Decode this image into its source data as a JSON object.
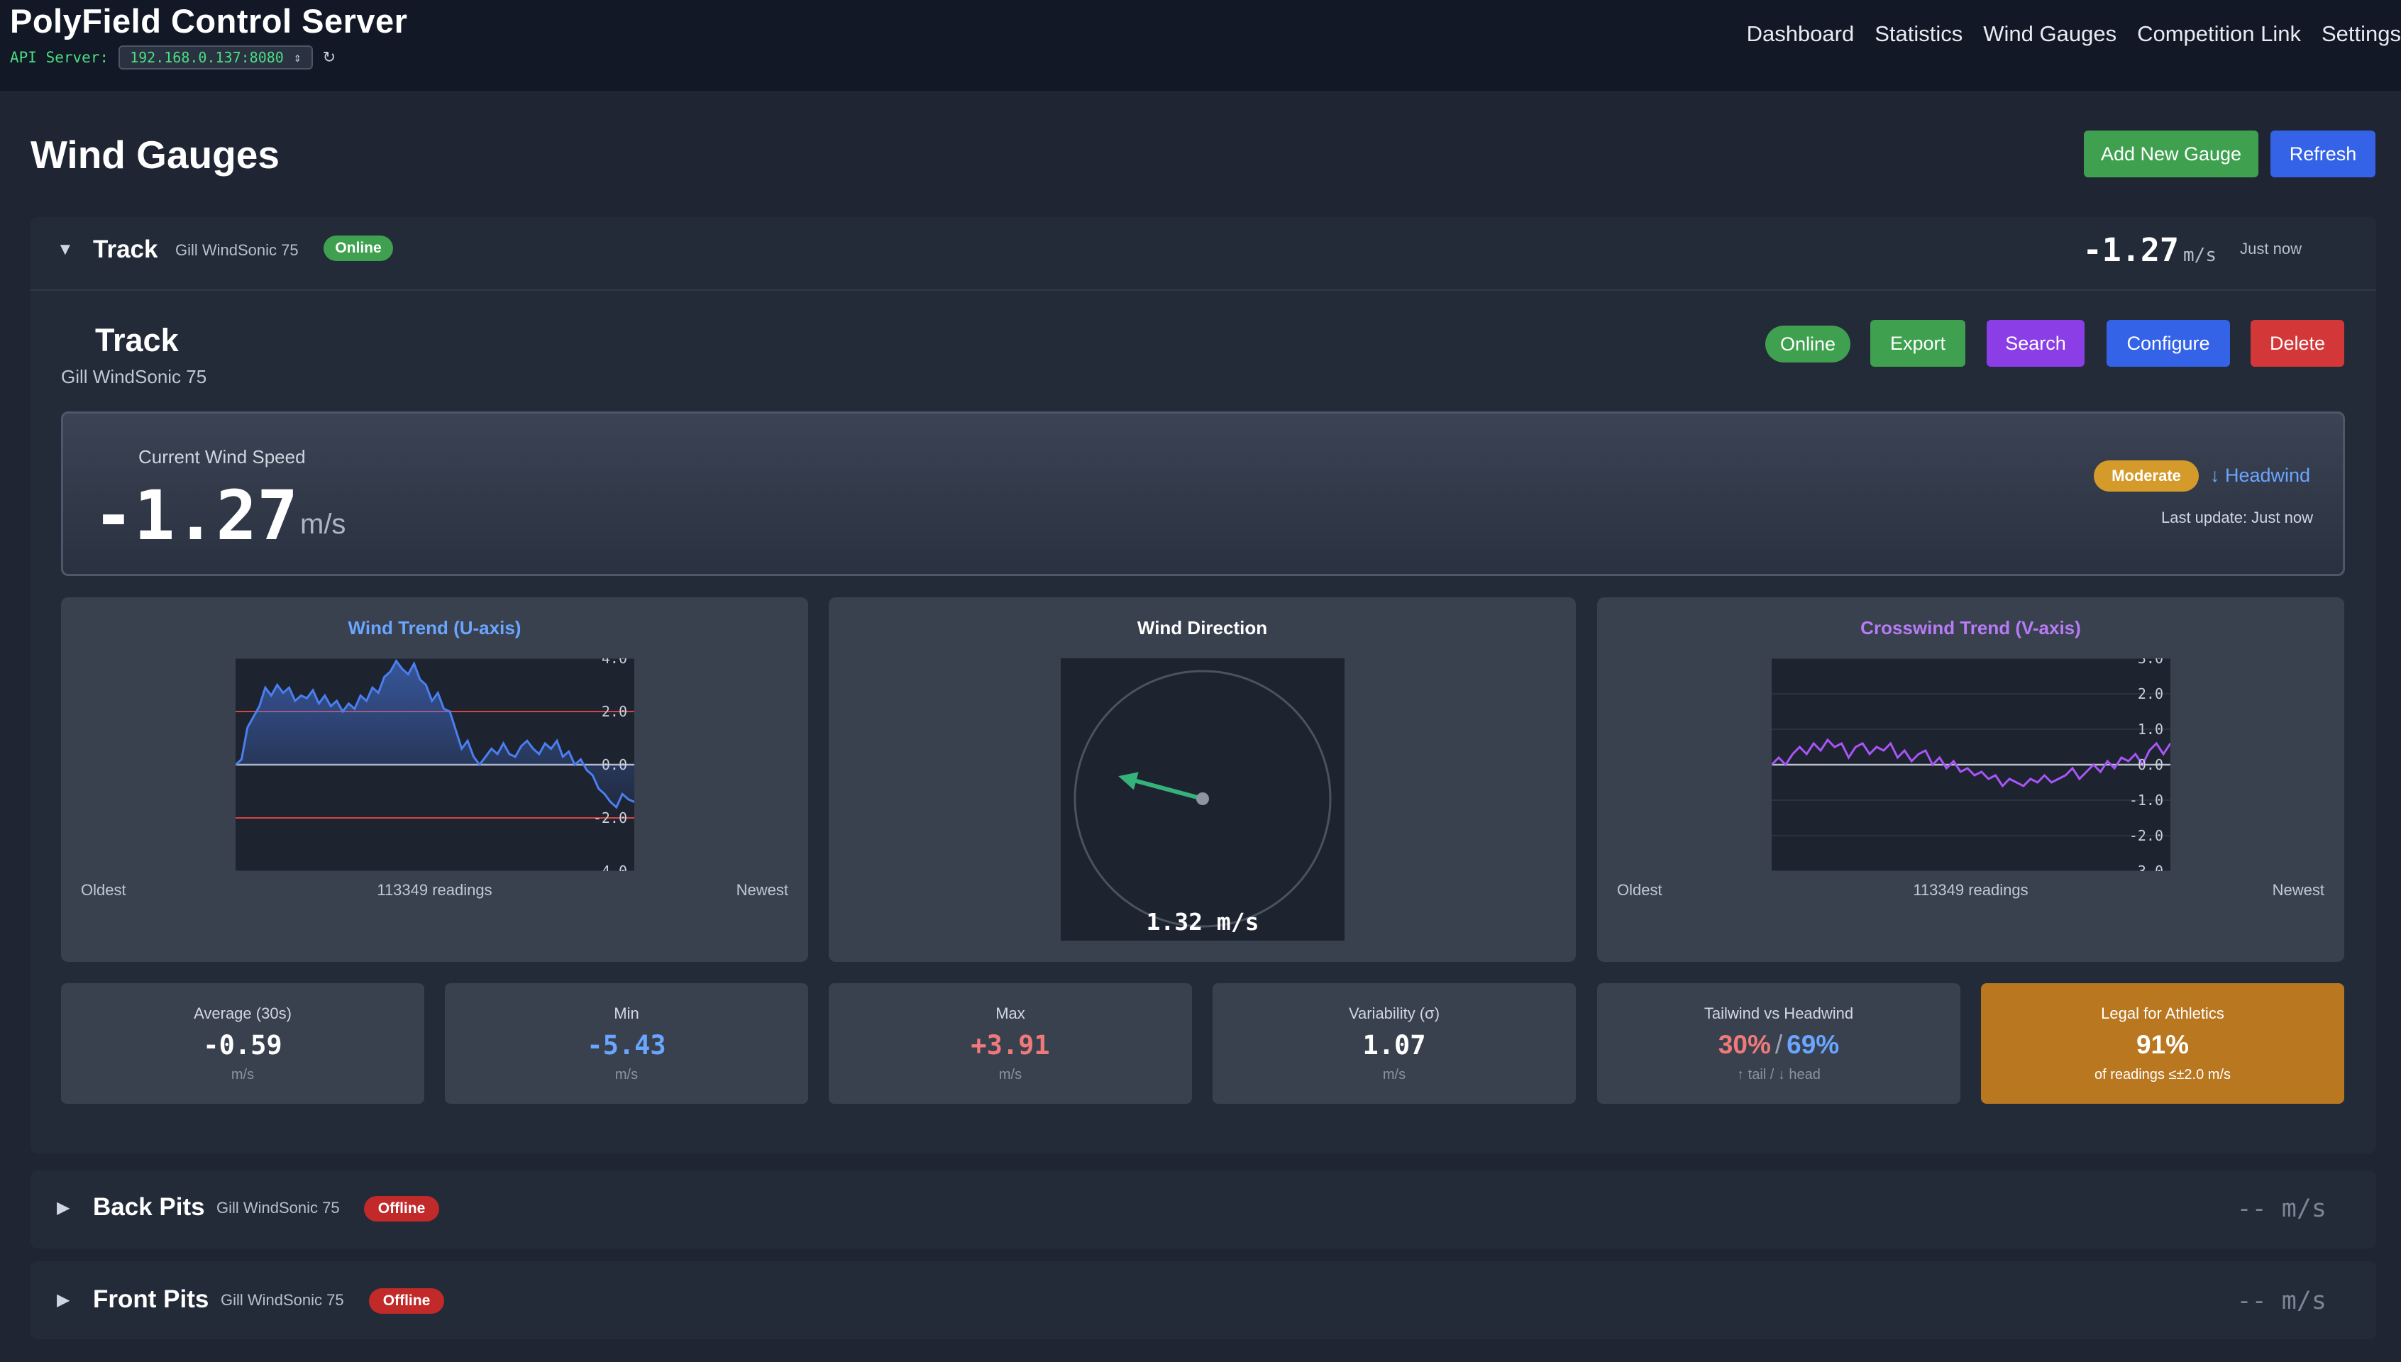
{
  "app": {
    "title": "PolyField Control Server",
    "api_label": "API Server:",
    "api_value": "192.168.0.137:8080"
  },
  "nav": [
    "Dashboard",
    "Statistics",
    "Wind Gauges",
    "Competition Link",
    "Settings"
  ],
  "page": {
    "title": "Wind Gauges",
    "add_button": "Add New Gauge",
    "refresh_button": "Refresh"
  },
  "gauges": [
    {
      "name": "Track",
      "model": "Gill WindSonic 75",
      "status": "Online",
      "speed": "-1.27",
      "unit": "m/s",
      "updated": "Just now",
      "expanded": true
    },
    {
      "name": "Back Pits",
      "model": "Gill WindSonic 75",
      "status": "Offline",
      "speed": "--",
      "unit": "m/s",
      "expanded": false
    },
    {
      "name": "Front Pits",
      "model": "Gill WindSonic 75",
      "status": "Offline",
      "speed": "--",
      "unit": "m/s",
      "expanded": false
    }
  ],
  "detail": {
    "title": "Track",
    "model": "Gill WindSonic 75",
    "status": "Online",
    "buttons": {
      "export": "Export",
      "search": "Search",
      "configure": "Configure",
      "delete": "Delete"
    },
    "current_label": "Current Wind Speed",
    "current_value": "-1.27",
    "current_unit": "m/s",
    "strength": "Moderate",
    "direction_label": "↓ Headwind",
    "last_update": "Last update: Just now"
  },
  "charts": {
    "u_trend": {
      "title": "Wind Trend (U-axis)",
      "oldest": "Oldest",
      "readings": "113349 readings",
      "newest": "Newest",
      "ticks": [
        "4.0",
        "2.0",
        "0.0",
        "-2.0",
        "-4.0"
      ]
    },
    "direction": {
      "title": "Wind Direction",
      "value": "1.32 m/s"
    },
    "v_trend": {
      "title": "Crosswind Trend (V-axis)",
      "oldest": "Oldest",
      "readings": "113349 readings",
      "newest": "Newest",
      "ticks": [
        "3.0",
        "2.0",
        "1.0",
        "0.0",
        "-1.0",
        "-2.0",
        "-3.0"
      ]
    }
  },
  "chart_data": [
    {
      "type": "area",
      "title": "Wind Trend (U-axis)",
      "ylim": [
        -4,
        4
      ],
      "limit_lines": [
        2.0,
        -2.0
      ],
      "color": "#4a7ff0",
      "values": [
        0.0,
        0.2,
        1.4,
        1.8,
        2.2,
        2.9,
        2.6,
        3.0,
        2.7,
        2.9,
        2.4,
        2.6,
        2.5,
        2.8,
        2.3,
        2.6,
        2.2,
        2.4,
        2.0,
        2.3,
        2.1,
        2.6,
        2.4,
        2.9,
        2.7,
        3.3,
        3.5,
        3.9,
        3.6,
        3.4,
        3.8,
        3.2,
        3.0,
        2.4,
        2.7,
        2.1,
        2.0,
        1.3,
        0.6,
        0.9,
        0.3,
        0.0,
        0.3,
        0.6,
        0.4,
        0.8,
        0.4,
        0.3,
        0.7,
        0.9,
        0.6,
        0.4,
        0.8,
        0.6,
        0.9,
        0.3,
        0.5,
        0.0,
        0.2,
        -0.2,
        -0.4,
        -0.9,
        -1.1,
        -1.4,
        -1.6,
        -1.1,
        -1.3,
        -1.4
      ]
    },
    {
      "type": "scatter",
      "title": "Wind Direction",
      "speed_ms": 1.32,
      "arrow_direction_deg": 285
    },
    {
      "type": "line",
      "title": "Crosswind Trend (V-axis)",
      "ylim": [
        -3,
        3
      ],
      "color": "#a855f7",
      "values": [
        0.0,
        0.2,
        0.0,
        0.3,
        0.5,
        0.3,
        0.6,
        0.4,
        0.7,
        0.5,
        0.6,
        0.2,
        0.5,
        0.6,
        0.3,
        0.5,
        0.4,
        0.6,
        0.2,
        0.4,
        0.1,
        0.3,
        0.4,
        0.0,
        0.2,
        -0.1,
        0.1,
        -0.2,
        -0.1,
        -0.3,
        -0.2,
        -0.4,
        -0.3,
        -0.6,
        -0.4,
        -0.5,
        -0.6,
        -0.4,
        -0.5,
        -0.3,
        -0.5,
        -0.4,
        -0.3,
        -0.1,
        -0.4,
        -0.2,
        0.0,
        -0.2,
        0.1,
        -0.1,
        0.2,
        0.1,
        0.3,
        0.0,
        0.4,
        0.6,
        0.3,
        0.6
      ]
    }
  ],
  "stats": [
    {
      "label": "Average (30s)",
      "value": "-0.59",
      "unit": "m/s",
      "color": "#ffffff"
    },
    {
      "label": "Min",
      "value": "-5.43",
      "unit": "m/s",
      "color": "#6aa5ff"
    },
    {
      "label": "Max",
      "value": "+3.91",
      "unit": "m/s",
      "color": "#f07a7a"
    },
    {
      "label": "Variability (σ)",
      "value": "1.07",
      "unit": "m/s",
      "color": "#ffffff"
    },
    {
      "label": "Tailwind vs Headwind",
      "tail": "30%",
      "sep": "/",
      "head": "69%",
      "unit": "↑ tail / ↓ head"
    },
    {
      "label": "Legal for Athletics",
      "value": "91%",
      "unit": "of readings ≤±2.0 m/s"
    }
  ],
  "colors": {
    "online": "#3fa14f",
    "offline": "#c22a2a",
    "accent_blue": "#3463e8",
    "accent_purple": "#8b3ee6",
    "delete_red": "#d43737",
    "legal_bg": "#b97720",
    "u_title": "#6aa5ff",
    "v_title": "#b77cf5"
  },
  "icons": {
    "api_refresh": "refresh-icon",
    "select_chevron": "chevron-updown-icon",
    "expanded": "caret-down-icon",
    "collapsed": "caret-right-icon"
  }
}
